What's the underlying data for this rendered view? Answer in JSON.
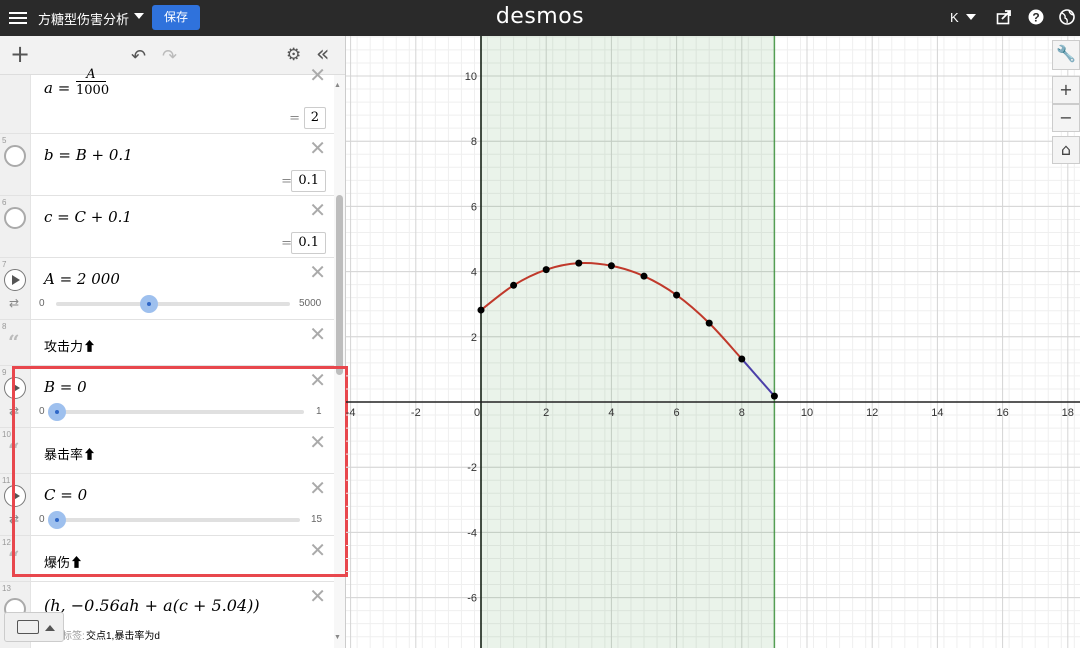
{
  "header": {
    "title": "方糖型伤害分析",
    "save_label": "保存",
    "logo": "desmos",
    "user_initial": "K"
  },
  "expressions": [
    {
      "index": "",
      "latex_lhs": "a =",
      "frac_num": "A",
      "frac_den": "1000",
      "value": "2"
    },
    {
      "index": "5",
      "text": "b = B + 0.1",
      "value": "0.1"
    },
    {
      "index": "6",
      "text": "c = C + 0.1",
      "value": "0.1"
    },
    {
      "index": "7",
      "text": "A = 2 000",
      "slider_min": "0",
      "slider_max": "5000",
      "slider_value": 2000
    },
    {
      "index": "8",
      "note": "攻击力⬆"
    },
    {
      "index": "9",
      "text": "B = 0",
      "slider_min": "0",
      "slider_max": "1",
      "slider_value": 0
    },
    {
      "index": "10",
      "note": "暴击率⬆"
    },
    {
      "index": "11",
      "text": "C = 0",
      "slider_min": "0",
      "slider_max": "15",
      "slider_value": 0
    },
    {
      "index": "12",
      "note": "爆伤⬆"
    },
    {
      "index": "13",
      "text": "(h, −0.56ah + a(c + 5.04))",
      "label_prefix": "标签:",
      "label_text": "交点1,暴击率为d"
    }
  ],
  "graph": {
    "x_ticks": [
      "-4",
      "-2",
      "0",
      "2",
      "4",
      "6",
      "8",
      "10",
      "12",
      "14",
      "16",
      "18"
    ],
    "y_ticks": [
      "10",
      "8",
      "6",
      "4",
      "2",
      "-2",
      "-4",
      "-6"
    ],
    "shade_x_range": [
      0,
      9
    ],
    "points": [
      [
        0,
        2.82
      ],
      [
        1,
        3.58
      ],
      [
        2,
        4.06
      ],
      [
        3,
        4.26
      ],
      [
        4,
        4.18
      ],
      [
        5,
        3.86
      ],
      [
        6,
        3.28
      ],
      [
        7,
        2.42
      ],
      [
        8,
        1.32
      ],
      [
        9,
        0.18
      ]
    ],
    "curve_color": "#c0392b",
    "tail_color": "#4b3fa8",
    "shade_color": "#2e8b2e"
  }
}
